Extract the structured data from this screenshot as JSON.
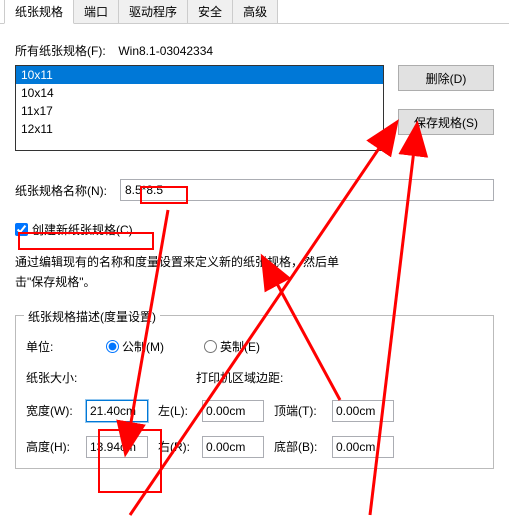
{
  "tabs": {
    "paper_spec": "纸张规格",
    "port": "端口",
    "driver": "驱动程序",
    "security": "安全",
    "advanced": "高级"
  },
  "all_specs_label": "所有纸张规格(F):",
  "title_value": "Win8.1-03042334",
  "list": {
    "items": [
      "10x11",
      "10x14",
      "11x17",
      "12x11"
    ],
    "selected_index": 0
  },
  "buttons": {
    "delete": "删除(D)",
    "save": "保存规格(S)"
  },
  "name_label": "纸张规格名称(N):",
  "name_value": "8.5*8.5",
  "create_new_label": "创建新纸张规格(C)",
  "help_text": "通过编辑现有的名称和度量设置来定义新的纸张规格，然后单击\"保存规格\"。",
  "fieldset_legend": "纸张规格描述(度量设置)",
  "unit_label": "单位:",
  "unit_metric": "公制(M)",
  "unit_english": "英制(E)",
  "paper_size_header": "纸张大小:",
  "printer_margin_header": "打印机区域边距:",
  "width_label": "宽度(W):",
  "width_value": "21.40cm",
  "height_label": "高度(H):",
  "height_value": "13.94cm",
  "left_label": "左(L):",
  "left_value": "0.00cm",
  "right_label": "右(R):",
  "right_value": "0.00cm",
  "top_label": "顶端(T):",
  "top_value": "0.00cm",
  "bottom_label": "底部(B):",
  "bottom_value": "0.00cm"
}
